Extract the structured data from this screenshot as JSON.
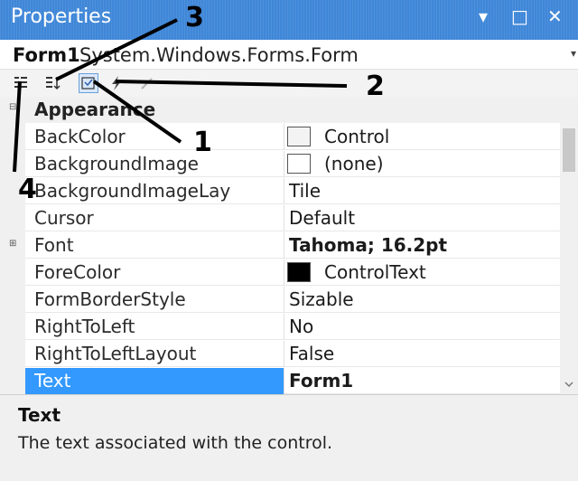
{
  "window": {
    "title": "Properties",
    "controls": [
      "▾",
      "□",
      "✕"
    ]
  },
  "object_selector": {
    "name": "Form1",
    "type": "System.Windows.Forms.Form",
    "dropdown_glyph": "▾"
  },
  "toolbar": {
    "buttons": [
      {
        "icon": "categorized-icon",
        "active": false
      },
      {
        "icon": "alphabetical-icon",
        "active": false
      },
      {
        "icon": "properties-icon",
        "active": true
      },
      {
        "icon": "events-icon",
        "active": false
      },
      {
        "icon": "property-pages-icon",
        "active": false
      }
    ]
  },
  "grid": {
    "category": "Appearance",
    "properties": [
      {
        "name": "BackColor",
        "value": "Control",
        "swatch": "#f3f3f3"
      },
      {
        "name": "BackgroundImage",
        "value": "(none)",
        "swatch": "#ffffff"
      },
      {
        "name": "BackgroundImageLay",
        "value": "Tile"
      },
      {
        "name": "Cursor",
        "value": "Default"
      },
      {
        "name": "Font",
        "value": "Tahoma; 16.2pt",
        "bold": true,
        "expandable": true
      },
      {
        "name": "ForeColor",
        "value": "ControlText",
        "swatch": "#000000"
      },
      {
        "name": "FormBorderStyle",
        "value": "Sizable"
      },
      {
        "name": "RightToLeft",
        "value": "No"
      },
      {
        "name": "RightToLeftLayout",
        "value": "False"
      },
      {
        "name": "Text",
        "value": "Form1",
        "bold": true,
        "selected": true
      }
    ]
  },
  "description": {
    "title": "Text",
    "text": "The text associated with the control."
  },
  "annotations": [
    "1",
    "2",
    "3",
    "4"
  ],
  "colors": {
    "titlebar": "#3f87d8",
    "selection": "#3399ff"
  }
}
